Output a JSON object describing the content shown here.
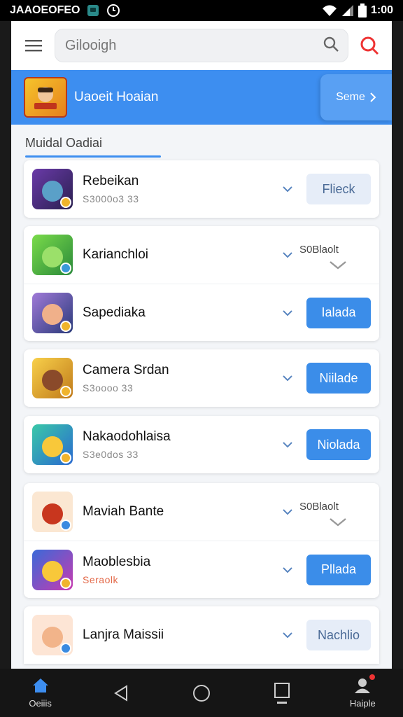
{
  "status_bar": {
    "left_text": "JAAOEOFEO",
    "time": "1:00"
  },
  "search": {
    "placeholder": "Gilooigh"
  },
  "banner": {
    "title": "Uaoeit Hoaian",
    "button_label": "Seme"
  },
  "section": {
    "title": "Muidal Oadiai"
  },
  "apps": [
    {
      "name": "Rebeikan",
      "sub": "S3000o3 33",
      "action": "Flieck",
      "action_style": "secondary",
      "icon_bg": "#4a3a7a"
    },
    {
      "name": "Karianchloi",
      "sub": "",
      "action": "S0Blaolt",
      "action_style": "text",
      "icon_bg": "#3aa84a"
    },
    {
      "name": "Sapediaka",
      "sub": "",
      "action": "Ialada",
      "action_style": "primary",
      "icon_bg": "#3a5aa0"
    },
    {
      "name": "Camera Srdan",
      "sub": "S3oooo 33",
      "action": "Niilade",
      "action_style": "primary",
      "icon_bg": "#e0a020"
    },
    {
      "name": "Nakaodohlaisa",
      "sub": "S3e0dos 33",
      "action": "Niolada",
      "action_style": "primary",
      "icon_bg": "#2a9a6a"
    },
    {
      "name": "Maviah Bante",
      "sub": "",
      "action": "S0Blaolt",
      "action_style": "text",
      "icon_bg": "#fbe7d2"
    },
    {
      "name": "Maoblesbia",
      "sub": "Seraolk",
      "sub_style": "orange",
      "action": "Pllada",
      "action_style": "primary",
      "icon_bg": "#2a4aa0"
    },
    {
      "name": "Lanjra Maissii",
      "sub": "",
      "action": "Nachlio",
      "action_style": "secondary",
      "icon_bg": "#fde5d5"
    }
  ],
  "nav": {
    "home_label": "Oeiiis",
    "profile_label": "Haiple"
  },
  "colors": {
    "accent": "#3d8ef0",
    "danger": "#e33"
  }
}
